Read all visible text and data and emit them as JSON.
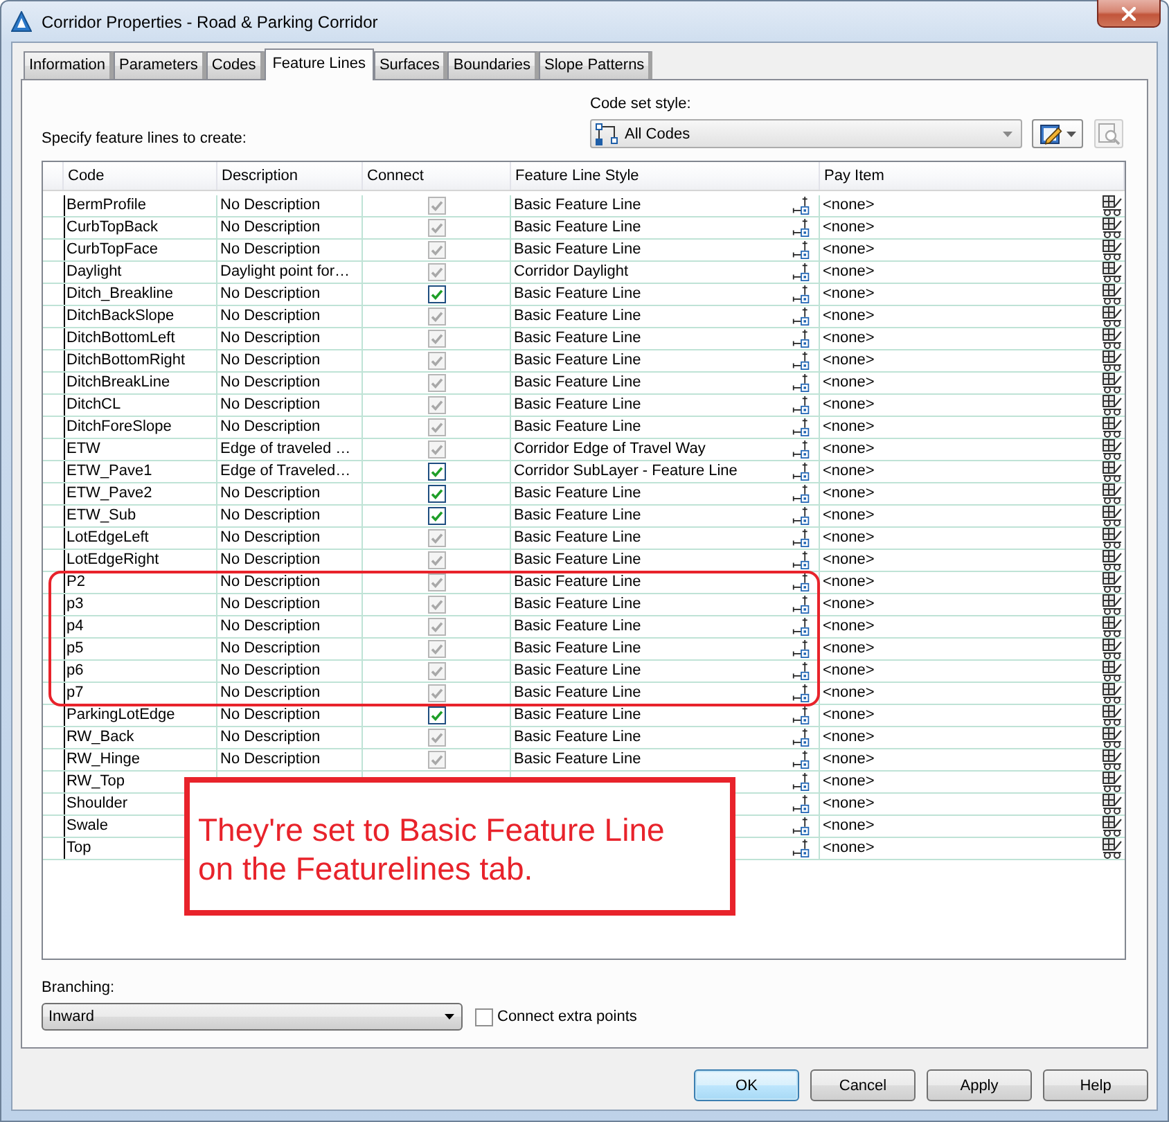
{
  "window": {
    "title": "Corridor Properties - Road & Parking Corridor"
  },
  "tabs": [
    {
      "label": "Information",
      "selected": false
    },
    {
      "label": "Parameters",
      "selected": false
    },
    {
      "label": "Codes",
      "selected": false
    },
    {
      "label": "Feature Lines",
      "selected": true
    },
    {
      "label": "Surfaces",
      "selected": false
    },
    {
      "label": "Boundaries",
      "selected": false
    },
    {
      "label": "Slope Patterns",
      "selected": false
    }
  ],
  "instruction": "Specify feature lines to create:",
  "code_set_style": {
    "label": "Code set style:",
    "value": "All Codes",
    "tools": [
      {
        "kind": "edit",
        "disabled": false
      },
      {
        "kind": "preview",
        "disabled": true
      }
    ]
  },
  "table": {
    "columns": [
      "Code",
      "Description",
      "Connect",
      "Feature Line Style",
      "Pay Item"
    ],
    "rows": [
      {
        "kind": "row",
        "code": "BermProfile",
        "description": "No Description",
        "connect": {
          "checked": true,
          "disabled": true
        },
        "style": "Basic Feature Line",
        "pay_item": "<none>"
      },
      {
        "kind": "row",
        "code": "CurbTopBack",
        "description": "No Description",
        "connect": {
          "checked": true,
          "disabled": true
        },
        "style": "Basic Feature Line",
        "pay_item": "<none>"
      },
      {
        "kind": "row",
        "code": "CurbTopFace",
        "description": "No Description",
        "connect": {
          "checked": true,
          "disabled": true
        },
        "style": "Basic Feature Line",
        "pay_item": "<none>"
      },
      {
        "kind": "row",
        "code": "Daylight",
        "description": "Daylight point for…",
        "connect": {
          "checked": true,
          "disabled": true
        },
        "style": "Corridor Daylight",
        "pay_item": "<none>"
      },
      {
        "kind": "row",
        "code": "Ditch_Breakline",
        "description": "No Description",
        "connect": {
          "checked": true,
          "disabled": false
        },
        "style": "Basic Feature Line",
        "pay_item": "<none>"
      },
      {
        "kind": "row",
        "code": "DitchBackSlope",
        "description": "No Description",
        "connect": {
          "checked": true,
          "disabled": true
        },
        "style": "Basic Feature Line",
        "pay_item": "<none>"
      },
      {
        "kind": "row",
        "code": "DitchBottomLeft",
        "description": "No Description",
        "connect": {
          "checked": true,
          "disabled": true
        },
        "style": "Basic Feature Line",
        "pay_item": "<none>"
      },
      {
        "kind": "row",
        "code": "DitchBottomRight",
        "description": "No Description",
        "connect": {
          "checked": true,
          "disabled": true
        },
        "style": "Basic Feature Line",
        "pay_item": "<none>"
      },
      {
        "kind": "row",
        "code": "DitchBreakLine",
        "description": "No Description",
        "connect": {
          "checked": true,
          "disabled": true
        },
        "style": "Basic Feature Line",
        "pay_item": "<none>"
      },
      {
        "kind": "row",
        "code": "DitchCL",
        "description": "No Description",
        "connect": {
          "checked": true,
          "disabled": true
        },
        "style": "Basic Feature Line",
        "pay_item": "<none>"
      },
      {
        "kind": "row",
        "code": "DitchForeSlope",
        "description": "No Description",
        "connect": {
          "checked": true,
          "disabled": true
        },
        "style": "Basic Feature Line",
        "pay_item": "<none>"
      },
      {
        "kind": "row",
        "code": "ETW",
        "description": "Edge of traveled …",
        "connect": {
          "checked": true,
          "disabled": true
        },
        "style": "Corridor Edge of Travel Way",
        "pay_item": "<none>"
      },
      {
        "kind": "row",
        "code": "ETW_Pave1",
        "description": "Edge of Traveled…",
        "connect": {
          "checked": true,
          "disabled": false
        },
        "style": "Corridor SubLayer - Feature Line",
        "pay_item": "<none>"
      },
      {
        "kind": "row",
        "code": "ETW_Pave2",
        "description": "No Description",
        "connect": {
          "checked": true,
          "disabled": false
        },
        "style": "Basic Feature Line",
        "pay_item": "<none>"
      },
      {
        "kind": "row",
        "code": "ETW_Sub",
        "description": "No Description",
        "connect": {
          "checked": true,
          "disabled": false
        },
        "style": "Basic Feature Line",
        "pay_item": "<none>"
      },
      {
        "kind": "row",
        "code": "LotEdgeLeft",
        "description": "No Description",
        "connect": {
          "checked": true,
          "disabled": true
        },
        "style": "Basic Feature Line",
        "pay_item": "<none>"
      },
      {
        "kind": "row",
        "code": "LotEdgeRight",
        "description": "No Description",
        "connect": {
          "checked": true,
          "disabled": true
        },
        "style": "Basic Feature Line",
        "pay_item": "<none>"
      },
      {
        "kind": "outlined_group",
        "rows": [
          {
            "kind": "row",
            "code": "P2",
            "description": "No Description",
            "connect": {
              "checked": true,
              "disabled": true
            },
            "style": "Basic Feature Line",
            "pay_item": "<none>"
          },
          {
            "kind": "row",
            "code": "p3",
            "description": "No Description",
            "connect": {
              "checked": true,
              "disabled": true
            },
            "style": "Basic Feature Line",
            "pay_item": "<none>"
          },
          {
            "kind": "row",
            "code": "p4",
            "description": "No Description",
            "connect": {
              "checked": true,
              "disabled": true
            },
            "style": "Basic Feature Line",
            "pay_item": "<none>"
          },
          {
            "kind": "row",
            "code": "p5",
            "description": "No Description",
            "connect": {
              "checked": true,
              "disabled": true
            },
            "style": "Basic Feature Line",
            "pay_item": "<none>"
          },
          {
            "kind": "row",
            "code": "p6",
            "description": "No Description",
            "connect": {
              "checked": true,
              "disabled": true
            },
            "style": "Basic Feature Line",
            "pay_item": "<none>"
          },
          {
            "kind": "row",
            "code": "p7",
            "description": "No Description",
            "connect": {
              "checked": true,
              "disabled": true
            },
            "style": "Basic Feature Line",
            "pay_item": "<none>"
          }
        ]
      },
      {
        "kind": "row",
        "code": "ParkingLotEdge",
        "description": "No Description",
        "connect": {
          "checked": true,
          "disabled": false
        },
        "style": "Basic Feature Line",
        "pay_item": "<none>"
      },
      {
        "kind": "row",
        "code": "RW_Back",
        "description": "No Description",
        "connect": {
          "checked": true,
          "disabled": true
        },
        "style": "Basic Feature Line",
        "pay_item": "<none>"
      },
      {
        "kind": "row",
        "code": "RW_Hinge",
        "description": "No Description",
        "connect": {
          "checked": true,
          "disabled": true
        },
        "style": "Basic Feature Line",
        "pay_item": "<none>"
      },
      {
        "kind": "row",
        "code": "RW_Top",
        "pay_item": "<none>"
      },
      {
        "kind": "row",
        "code": "Shoulder",
        "pay_item": "<none>"
      },
      {
        "kind": "row",
        "code": "Swale",
        "pay_item": "<none>"
      },
      {
        "kind": "row",
        "code": "Top",
        "pay_item": "<none>"
      }
    ]
  },
  "note": "They're set to Basic Feature Line on the Featurelines tab.",
  "branching": {
    "label": "Branching:",
    "value": "Inward"
  },
  "connect_extra_points": {
    "label": "Connect extra points",
    "checked": false
  },
  "buttons": [
    {
      "label": "OK",
      "default": true
    },
    {
      "label": "Cancel",
      "default": false
    },
    {
      "label": "Apply",
      "default": false
    },
    {
      "label": "Help",
      "default": false
    }
  ]
}
